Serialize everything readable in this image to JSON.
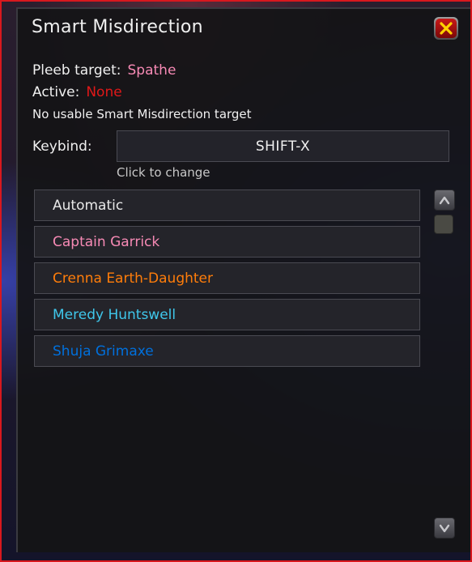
{
  "window": {
    "title": "Smart Misdirection"
  },
  "status": {
    "pleeb_label": "Pleeb target:",
    "pleeb_value": "Spathe",
    "active_label": "Active:",
    "active_value": "None",
    "message": "No usable Smart Misdirection target"
  },
  "keybind": {
    "label": "Keybind:",
    "value": "SHIFT-X",
    "hint": "Click to change"
  },
  "targets": [
    {
      "name": "Automatic",
      "color": "#e8e8e8"
    },
    {
      "name": "Captain Garrick",
      "color": "#f78ab5"
    },
    {
      "name": "Crenna Earth-Daughter",
      "color": "#ff7d0a"
    },
    {
      "name": "Meredy Huntswell",
      "color": "#3fc7eb"
    },
    {
      "name": "Shuja Grimaxe",
      "color": "#0070dd"
    }
  ],
  "colors": {
    "accent_red": "#d8181e",
    "pleeb_pink": "#f78ab5",
    "none_red": "#e01818"
  },
  "icons": {
    "close": "close-icon",
    "scroll_up": "chevron-up-icon",
    "scroll_down": "chevron-down-icon"
  }
}
